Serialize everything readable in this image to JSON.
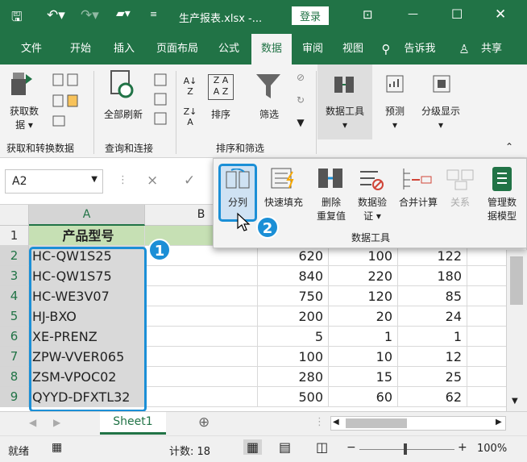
{
  "title": {
    "file": "生产报表.xlsx -...",
    "login": "登录"
  },
  "menu": [
    "文件",
    "开始",
    "插入",
    "页面布局",
    "公式",
    "数据",
    "审阅",
    "视图",
    "告诉我",
    "共享"
  ],
  "ribbon": {
    "get_data": "获取数\n据",
    "refresh_all": "全部刷新",
    "sort": "排序",
    "filter": "筛选",
    "data_tools": "数据工具",
    "forecast": "预测",
    "outline": "分级显示",
    "groups": [
      "获取和转换数据",
      "查询和连接",
      "排序和筛选"
    ]
  },
  "formula": {
    "name_box": "A2",
    "cancel": "×",
    "enter": "✓"
  },
  "popup": {
    "items": [
      "分列",
      "快速填充",
      "删除\n重复值",
      "数据验\n证",
      "合并计算",
      "关系",
      "管理数\n据模型"
    ],
    "group": "数据工具"
  },
  "grid": {
    "col_a": "A",
    "col_b": "B",
    "header": "产品型号",
    "rows": [
      {
        "n": "1"
      },
      {
        "n": "2",
        "a": "HC-QW1S25",
        "c": "620",
        "d": "100",
        "e": "122"
      },
      {
        "n": "3",
        "a": "HC-QW1S75",
        "c": "840",
        "d": "220",
        "e": "180"
      },
      {
        "n": "4",
        "a": "HC-WE3V07",
        "c": "750",
        "d": "120",
        "e": "85"
      },
      {
        "n": "5",
        "a": "HJ-BXO",
        "c": "200",
        "d": "20",
        "e": "24"
      },
      {
        "n": "6",
        "a": "XE-PRENZ",
        "c": "5",
        "d": "1",
        "e": "1"
      },
      {
        "n": "7",
        "a": "ZPW-VVER065",
        "c": "100",
        "d": "10",
        "e": "12"
      },
      {
        "n": "8",
        "a": "ZSM-VPOC02",
        "c": "280",
        "d": "15",
        "e": "25"
      },
      {
        "n": "9",
        "a": "QYYD-DFXTL32",
        "c": "500",
        "d": "60",
        "e": "62"
      }
    ]
  },
  "sheet_tab": "Sheet1",
  "status": {
    "ready": "就绪",
    "count": "计数: 18",
    "zoom": "100%"
  },
  "badges": [
    "1",
    "2"
  ]
}
